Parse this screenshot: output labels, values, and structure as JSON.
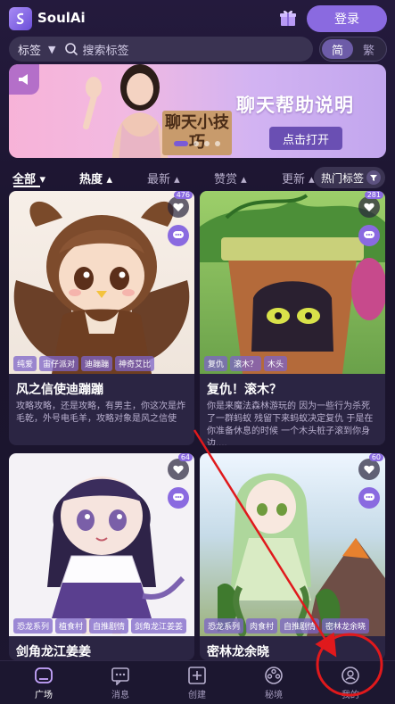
{
  "app": {
    "title": "SoulAi",
    "login_label": "登录"
  },
  "search": {
    "tag_label": "标签",
    "placeholder": "搜索标签",
    "lang_simplified": "简",
    "lang_traditional": "繁"
  },
  "banner": {
    "title": "聊天帮助说明",
    "button_label": "点击打开",
    "sign_text": "聊天小技巧"
  },
  "sort_tabs": [
    {
      "label": "全部 ▾"
    },
    {
      "label": "热度 ▴"
    },
    {
      "label": "最新 ▴"
    },
    {
      "label": "赞赏 ▴"
    },
    {
      "label": "更新 ▴"
    }
  ],
  "hot_tags_label": "热门标签",
  "cards": [
    {
      "title": "风之信使迪蹦蹦",
      "tags": [
        "纯爱",
        "宙仔派对",
        "迪蹦蹦",
        "神奇艾比"
      ],
      "desc": "攻略攻略，还是攻略，有男主，你这次是炸毛乾，外号电毛羊，攻略对象是风之信使",
      "likes": "476"
    },
    {
      "title": "复仇！滚木？",
      "tags": [
        "复仇",
        "滚木？",
        "木头"
      ],
      "desc": "你是来魔法森林游玩的 因为一些行为杀死了一群蚂蚁 残留下来蚂蚁决定复仇 于是在你准备休息的时候 一个木头桩子滚到你身边....",
      "likes": "281"
    },
    {
      "title": "剑角龙江姜姜",
      "tags": [
        "恐龙系列",
        "植食村",
        "自推剧情",
        "剑角龙江姜姜"
      ],
      "desc": "",
      "likes": "64"
    },
    {
      "title": "密林龙余晓",
      "tags": [
        "恐龙系列",
        "肉食村",
        "自推剧情",
        "密林龙余晓"
      ],
      "desc": "",
      "likes": "60"
    }
  ],
  "bottom_nav": [
    {
      "label": "广场"
    },
    {
      "label": "消息"
    },
    {
      "label": "创建"
    },
    {
      "label": "秘境"
    },
    {
      "label": "我的"
    }
  ],
  "colors": {
    "accent": "#8a6ae0",
    "background": "#1d1630",
    "annotation": "#e0191c"
  }
}
